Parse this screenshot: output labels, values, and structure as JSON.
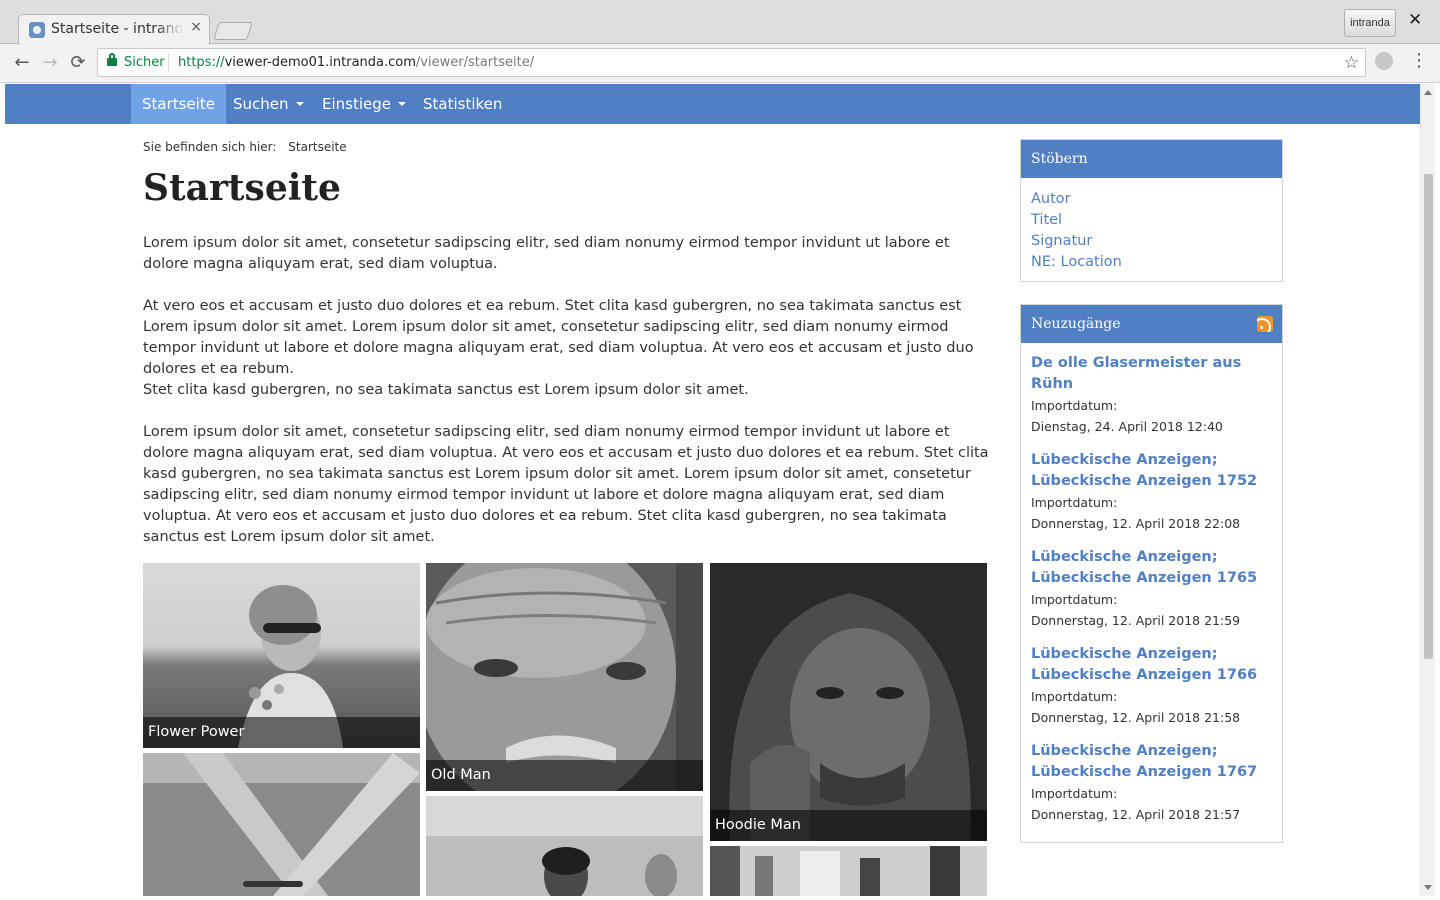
{
  "browser": {
    "tab_title": "Startseite - intranda",
    "tab_close": "×",
    "profile_label": "intranda",
    "window_close": "✕",
    "back_icon": "←",
    "forward_icon": "→",
    "reload_icon": "⟳",
    "secure_label": "Sicher",
    "url_scheme": "https://",
    "url_host": "viewer-demo01.intranda.com",
    "url_path": "/viewer/startseite/",
    "bookmark_icon": "☆",
    "menu_icon": "⋮"
  },
  "navbar": {
    "items": [
      {
        "label": "Startseite",
        "active": true,
        "dropdown": false
      },
      {
        "label": "Suchen",
        "active": false,
        "dropdown": true
      },
      {
        "label": "Einstiege",
        "active": false,
        "dropdown": true
      },
      {
        "label": "Statistiken",
        "active": false,
        "dropdown": false
      }
    ],
    "color": "#517fc4",
    "active_color": "#70a3e6"
  },
  "breadcrumb": {
    "prefix": "Sie befinden sich hier:",
    "current": "Startseite"
  },
  "page": {
    "title": "Startseite",
    "paragraphs": [
      "Lorem ipsum dolor sit amet, consetetur sadipscing elitr, sed diam nonumy eirmod tempor invidunt ut labore et dolore magna aliquyam erat, sed diam voluptua.",
      "At vero eos et accusam et justo duo dolores et ea rebum. Stet clita kasd gubergren, no sea takimata sanctus est Lorem ipsum dolor sit amet. Lorem ipsum dolor sit amet, consetetur sadipscing elitr, sed diam nonumy eirmod tempor invidunt ut labore et dolore magna aliquyam erat, sed diam voluptua. At vero eos et accusam et justo duo dolores et ea rebum.",
      "Stet clita kasd gubergren, no sea takimata sanctus est Lorem ipsum dolor sit amet.",
      "Lorem ipsum dolor sit amet, consetetur sadipscing elitr, sed diam nonumy eirmod tempor invidunt ut labore et dolore magna aliquyam erat, sed diam voluptua. At vero eos et accusam et justo duo dolores et ea rebum. Stet clita kasd gubergren, no sea takimata sanctus est Lorem ipsum dolor sit amet. Lorem ipsum dolor sit amet, consetetur sadipscing elitr, sed diam nonumy eirmod tempor invidunt ut labore et dolore magna aliquyam erat, sed diam voluptua. At vero eos et accusam et justo duo dolores et ea rebum. Stet clita kasd gubergren, no sea takimata sanctus est Lorem ipsum dolor sit amet."
    ],
    "gallery": [
      {
        "caption": "Flower Power"
      },
      {
        "caption": "Old Man"
      },
      {
        "caption": "Hoodie Man"
      }
    ]
  },
  "sidebar": {
    "browse": {
      "title": "Stöbern",
      "items": [
        "Autor",
        "Titel",
        "Signatur",
        "NE: Location"
      ]
    },
    "new_items": {
      "title": "Neuzugänge",
      "rss_icon": "rss-icon",
      "entries": [
        {
          "title": "De olle Glasermeister aus Rühn",
          "label": "Importdatum:",
          "date": "Dienstag, 24. April 2018 12:40"
        },
        {
          "title": "Lübeckische Anzeigen; Lübeckische Anzeigen 1752",
          "label": "Importdatum:",
          "date": "Donnerstag, 12. April 2018 22:08"
        },
        {
          "title": "Lübeckische Anzeigen; Lübeckische Anzeigen 1765",
          "label": "Importdatum:",
          "date": "Donnerstag, 12. April 2018 21:59"
        },
        {
          "title": "Lübeckische Anzeigen; Lübeckische Anzeigen 1766",
          "label": "Importdatum:",
          "date": "Donnerstag, 12. April 2018 21:58"
        },
        {
          "title": "Lübeckische Anzeigen; Lübeckische Anzeigen 1767",
          "label": "Importdatum:",
          "date": "Donnerstag, 12. April 2018 21:57"
        }
      ]
    }
  }
}
